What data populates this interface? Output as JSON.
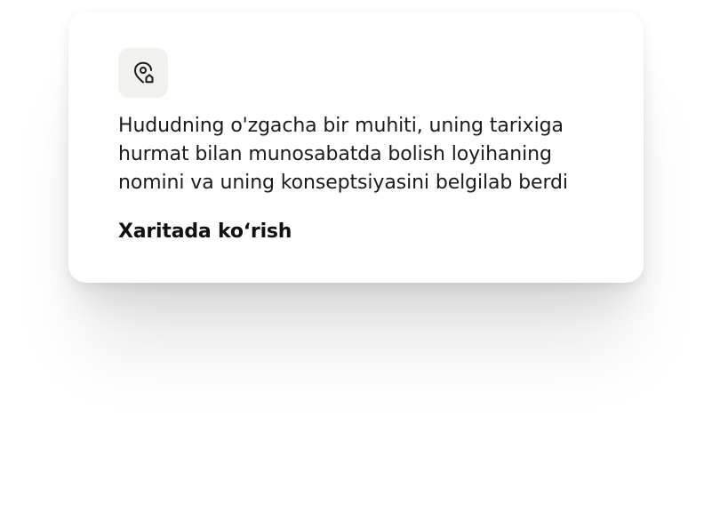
{
  "card": {
    "icon": "map-pin-home-icon",
    "description": "Hududning o'zgacha bir muhiti, uning tarixiga hurmat bilan munosabatda bolish loyihaning nomini va uning konseptsiyasini belgilab berdi",
    "link_label": "Xaritada ko‘rish"
  },
  "colors": {
    "icon_background": "#f1f1ee",
    "text": "#1b1b1b",
    "card_background": "#ffffff"
  }
}
